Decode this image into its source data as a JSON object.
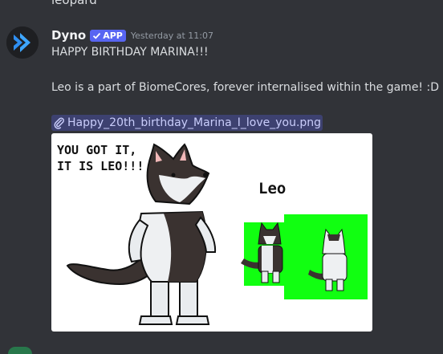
{
  "previous_message": {
    "text": "leopard"
  },
  "message": {
    "author": "Dyno",
    "badge": "APP",
    "timestamp": "Yesterday at 11:07",
    "lines": [
      "HAPPY BIRTHDAY MARINA!!!",
      "Leo is a part of BiomeCores, forever internalised within the game! :D"
    ],
    "attachment": {
      "filename": "Happy_20th_birthday_Marina_I_love_you.png",
      "image_text": {
        "caption": "YOU GOT IT,\nIT IS LEO!!!",
        "name": "Leo"
      }
    }
  },
  "colors": {
    "background": "#313338",
    "badge": "#5865f2",
    "green_swatch": "#11ff11"
  },
  "icons": {
    "avatar": "dyno-logo-icon",
    "badge_check": "checkmark-icon",
    "attachment": "paperclip-icon"
  }
}
